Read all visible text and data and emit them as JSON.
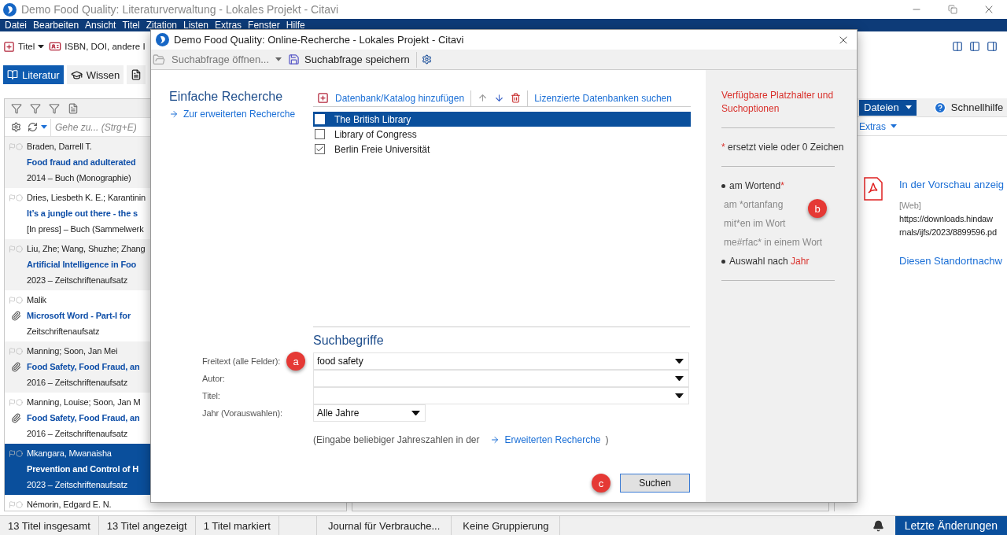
{
  "app_window": {
    "title": "Demo Food Quality: Literaturverwaltung - Lokales Projekt - Citavi"
  },
  "menu_bar": [
    "Datei",
    "Bearbeiten",
    "Ansicht",
    "Titel",
    "Zitation",
    "Listen",
    "Extras",
    "Fenster",
    "Hilfe"
  ],
  "toolbar": {
    "new_title": "Titel",
    "isbn_field": "ISBN, DOI, andere I"
  },
  "nav_tabs": [
    {
      "label": "Literatur",
      "selected": true
    },
    {
      "label": "Wissen",
      "selected": false
    }
  ],
  "reference_list": {
    "goto_placeholder": "Gehe zu... (Strg+E)",
    "items": [
      {
        "author": "Braden, Darrell T.",
        "title": "Food fraud and adulterated",
        "meta": "2014 – Buch (Monographie)",
        "attachment": false,
        "selected": false
      },
      {
        "author": "Dries, Liesbeth K. E.; Karantinin",
        "title": "It’s a jungle out there - the s",
        "meta": "[In press] – Buch (Sammelwerk",
        "attachment": false,
        "selected": false
      },
      {
        "author": "Liu, Zhe; Wang, Shuzhe; Zhang",
        "title": "Artificial Intelligence in Foo",
        "meta": "2023 – Zeitschriftenaufsatz",
        "attachment": false,
        "selected": false
      },
      {
        "author": "Malik",
        "title": "Microsoft Word - Part-I for",
        "meta": "Zeitschriftenaufsatz",
        "attachment": true,
        "selected": false
      },
      {
        "author": "Manning; Soon, Jan Mei",
        "title": "Food Safety, Food Fraud, an",
        "meta": "2016 – Zeitschriftenaufsatz",
        "attachment": true,
        "selected": false
      },
      {
        "author": "Manning, Louise; Soon, Jan M",
        "title": "Food Safety, Food Fraud, an",
        "meta": "2016 – Zeitschriftenaufsatz",
        "attachment": true,
        "selected": false
      },
      {
        "author": "Mkangara, Mwanaisha",
        "title": "Prevention and Control of H",
        "meta": "2023 – Zeitschriftenaufsatz",
        "attachment": false,
        "selected": true
      },
      {
        "author": "Némorin, Edgard E. N.",
        "selected": false
      }
    ]
  },
  "preview_pane": {
    "files_button": "Dateien",
    "help_button": "Schnellhilfe",
    "extras_menu": "Extras",
    "preview_link": "In der Vorschau anzeig",
    "source_label": "[Web]",
    "url_lines": [
      "https://downloads.hindaw",
      "rnals/ijfs/2023/8899596.pd"
    ],
    "location_link": "Diesen Standortnachw"
  },
  "status_bar": {
    "cells": [
      "13 Titel insgesamt",
      "13 Titel angezeigt",
      "1 Titel markiert",
      "Journal für Verbrauche...",
      "Keine Gruppierung"
    ],
    "latest_changes_button": "Letzte Änderungen"
  },
  "dialog": {
    "title": "Demo Food Quality: Online-Recherche - Lokales Projekt - Citavi",
    "toolbar": {
      "open_query": "Suchabfrage öffnen...",
      "open_disabled": true,
      "save_query": "Suchabfrage speichern"
    },
    "simple_search": {
      "heading": "Einfache Recherche",
      "advanced_link": "Zur erweiterten Recherche"
    },
    "databases": {
      "add_button": "Datenbank/Katalog hinzufügen",
      "licensed_link": "Lizenzierte Datenbanken suchen",
      "items": [
        {
          "name": "The British Library",
          "checked": false,
          "selected": true
        },
        {
          "name": "Library of Congress",
          "checked": false,
          "selected": false
        },
        {
          "name": "Berlin Freie Universität",
          "checked": true,
          "selected": false
        }
      ]
    },
    "search_terms": {
      "heading": "Suchbegriffe",
      "fields": [
        {
          "label": "Freitext (alle Felder):",
          "value": "food safety",
          "callout": "a"
        },
        {
          "label": "Autor:"
        },
        {
          "label": "Titel:"
        }
      ],
      "year": {
        "label": "Jahr (Vorauswahlen):",
        "value": "Alle Jahre"
      },
      "hint": "(Eingabe beliebiger Jahreszahlen in der",
      "hint_link": "Erweiterten Recherche",
      "hint_close": ")"
    },
    "search_button": "Suchen",
    "search_callout": "c",
    "help_panel": {
      "heading": "Verfügbare Platzhalter und Suchoptionen",
      "callout": "b",
      "sections": [
        [
          {
            "kind": "legend",
            "accent": "*",
            "text": " ersetzt viele oder 0 Zeichen"
          }
        ],
        [
          {
            "kind": "bullet",
            "text": "am Wortend",
            "accent": "*"
          },
          {
            "kind": "example",
            "text": "am *ortanfang"
          },
          {
            "kind": "example",
            "text": "mit*en im Wort"
          },
          {
            "kind": "example",
            "text": "me#rfac* in einem Wort"
          },
          {
            "kind": "bullet",
            "text": "Auswahl nach ",
            "accent": "Jahr"
          }
        ]
      ]
    }
  }
}
